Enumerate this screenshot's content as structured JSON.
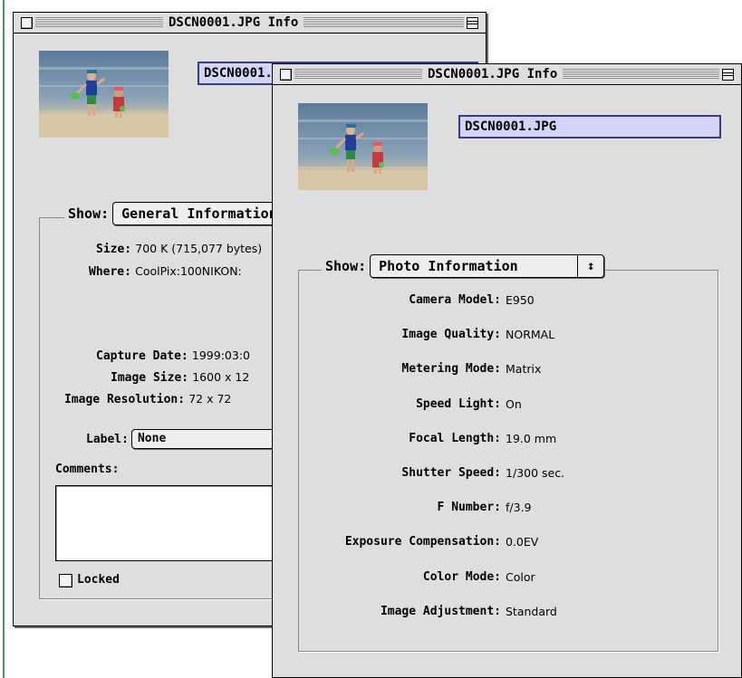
{
  "back_window": {
    "title": "DSCN0001.JPG Info",
    "name_value": "DSCN0001.JPG",
    "show_label": "Show:",
    "show_selected": "General Information",
    "size_label": "Size:",
    "size_value": "700 K (715,077 bytes)",
    "where_label": "Where:",
    "where_value": "CoolPix:100NIKON:",
    "capture_date_label": "Capture Date:",
    "capture_date_value": "1999:03:0",
    "image_size_label": "Image Size:",
    "image_size_value": "1600 x 12",
    "image_resolution_label": "Image Resolution:",
    "image_resolution_value": "72 x 72",
    "label_label": "Label:",
    "label_selected": "None",
    "comments_label": "Comments:",
    "locked_label": "Locked",
    "locked_checked": false
  },
  "front_window": {
    "title": "DSCN0001.JPG Info",
    "name_value": "DSCN0001.JPG",
    "show_label": "Show:",
    "show_selected": "Photo Information",
    "popup_arrow": "↕",
    "fields": [
      {
        "label": "Camera Model:",
        "value": "E950"
      },
      {
        "label": "Image Quality:",
        "value": "NORMAL"
      },
      {
        "label": "Metering Mode:",
        "value": "Matrix"
      },
      {
        "label": "Speed Light:",
        "value": "On"
      },
      {
        "label": "Focal Length:",
        "value": "19.0 mm"
      },
      {
        "label": "Shutter Speed:",
        "value": "1/300 sec."
      },
      {
        "label": "F Number:",
        "value": "f/3.9"
      },
      {
        "label": "Exposure Compensation:",
        "value": "0.0EV"
      },
      {
        "label": "Color Mode:",
        "value": "Color"
      },
      {
        "label": "Image Adjustment:",
        "value": "Standard"
      }
    ]
  },
  "icons": {
    "close": "close-box-icon",
    "zoom": "zoom-box-icon",
    "popup": "popup-arrows-icon",
    "checkbox": "checkbox-icon"
  },
  "colors": {
    "window_bg": "#dedede",
    "name_field_bg": "#d4d4f8",
    "name_field_border": "#3a3a8a",
    "page_rule": "#3e9a66"
  }
}
